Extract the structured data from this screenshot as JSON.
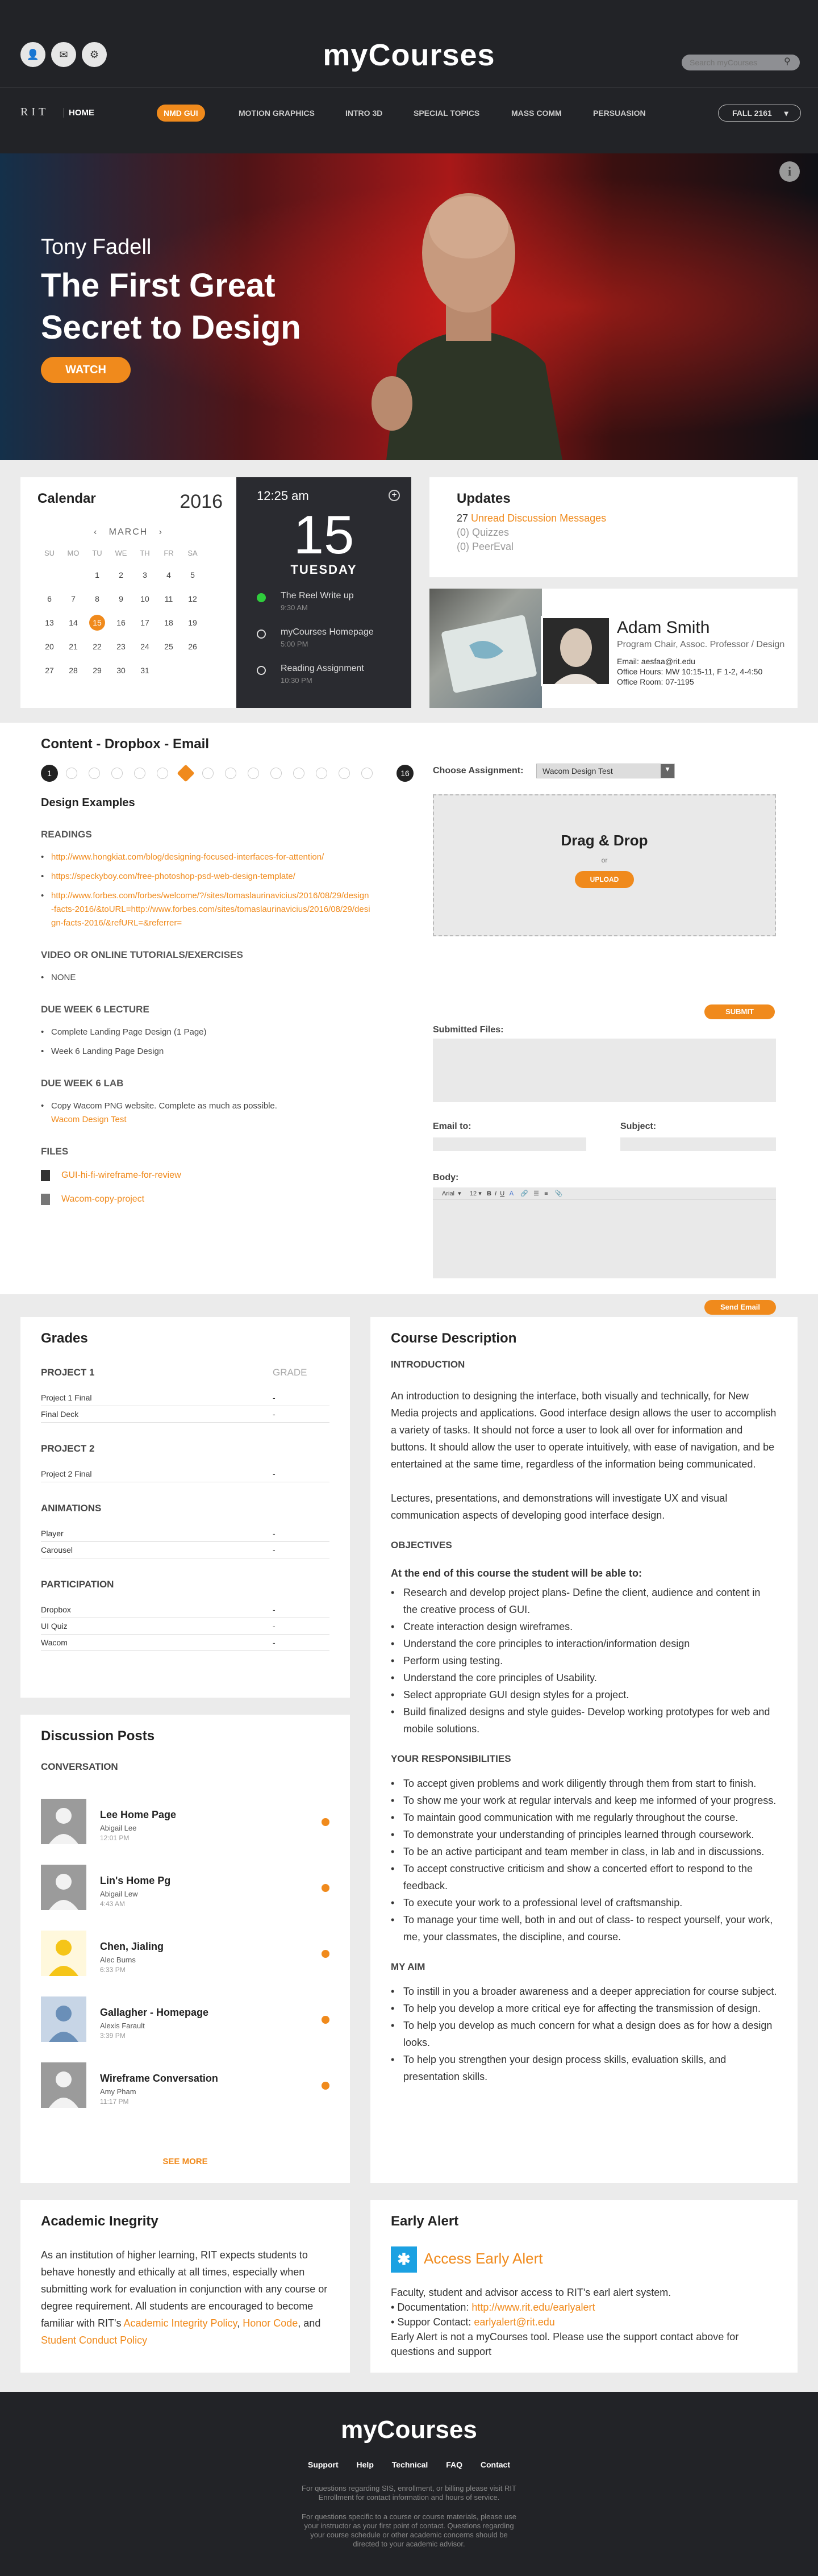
{
  "header": {
    "brand": "myCourses",
    "search_placeholder": "Search myCourses",
    "rit": "RIT",
    "home": "HOME",
    "nav": [
      "NMD GUI",
      "MOTION GRAPHICS",
      "INTRO 3D",
      "SPECIAL TOPICS",
      "MASS COMM",
      "PERSUASION"
    ],
    "term": "FALL 2161"
  },
  "hero": {
    "kicker": "Tony Fadell",
    "title": "The First Great Secret to Design",
    "watch": "WATCH"
  },
  "calendar": {
    "title": "Calendar",
    "year": "2016",
    "month": "MARCH",
    "days_header": [
      "SU",
      "MO",
      "TU",
      "WE",
      "TH",
      "FR",
      "SA"
    ],
    "rows": [
      [
        "",
        "",
        "1",
        "2",
        "3",
        "4",
        "5"
      ],
      [
        "6",
        "7",
        "8",
        "9",
        "10",
        "11",
        "12"
      ],
      [
        "13",
        "14",
        "15",
        "16",
        "17",
        "18",
        "19"
      ],
      [
        "20",
        "21",
        "22",
        "23",
        "24",
        "25",
        "26"
      ],
      [
        "27",
        "28",
        "29",
        "30",
        "31",
        "",
        ""
      ]
    ],
    "selected": "15"
  },
  "day": {
    "time": "12:25 am",
    "num": "15",
    "dow": "TUESDAY",
    "events": [
      {
        "name": "The Reel Write up",
        "time": "9:30 AM"
      },
      {
        "name": "myCourses Homepage",
        "time": "5:00 PM"
      },
      {
        "name": "Reading Assignment",
        "time": "10:30 PM"
      }
    ]
  },
  "updates": {
    "title": "Updates",
    "unread_count": "27",
    "unread": "Unread Discussion Messages",
    "quizzes": "(0) Quizzes",
    "peer": "(0) PeerEval"
  },
  "profile": {
    "name": "Adam Smith",
    "role": "Program Chair, Assoc. Professor / Design",
    "email": "Email: aesfaa@rit.edu",
    "hours": "Office Hours: MW 10:15-11, F 1-2, 4-4:50",
    "room": "Office Room: 07-1195"
  },
  "dropbox": {
    "title": "Content - Dropbox - Email",
    "step_first": "1",
    "step_last": "16",
    "heading": "Design Examples",
    "readings_label": "READINGS",
    "readings": [
      "http://www.hongkiat.com/blog/designing-focused-interfaces-for-attention/",
      "https://speckyboy.com/free-photoshop-psd-web-design-template/",
      "http://www.forbes.com/forbes/welcome/?/sites/tomaslaurinavicius/2016/08/29/design-facts-2016/&toURL=http://www.forbes.com/sites/tomaslaurinavicius/2016/08/29/design-facts-2016/&refURL=&referrer="
    ],
    "video_label": "VIDEO OR ONLINE TUTORIALS/EXERCISES",
    "video_items": [
      "NONE"
    ],
    "lecture_label": "DUE WEEK 6 LECTURE",
    "lecture_items": [
      "Complete Landing Page Design (1 Page)",
      "Week 6 Landing Page Design"
    ],
    "lab_label": "DUE WEEK 6 LAB",
    "lab_item": "Copy Wacom PNG website. Complete as much as possible.",
    "lab_link": "Wacom Design Test",
    "files_label": "FILES",
    "files": [
      "GUI-hi-fi-wireframe-for-review",
      "Wacom-copy-project"
    ],
    "choose_label": "Choose Assignment:",
    "choose_value": "Wacom Design Test",
    "drop_title": "Drag & Drop",
    "drop_or": "or",
    "upload": "UPLOAD",
    "submit": "SUBMIT",
    "submitted_label": "Submitted Files:",
    "email_label": "Email to:",
    "subject_label": "Subject:",
    "body_label": "Body:",
    "font": "Arial",
    "size": "12",
    "send": "Send Email"
  },
  "grades": {
    "title": "Grades",
    "grade_col": "GRADE",
    "sections": [
      {
        "name": "PROJECT 1",
        "rows": [
          [
            "Project 1 Final",
            "-"
          ],
          [
            "Final Deck",
            "-"
          ]
        ]
      },
      {
        "name": "PROJECT 2",
        "rows": [
          [
            "Project 2 Final",
            "-"
          ]
        ]
      },
      {
        "name": "ANIMATIONS",
        "rows": [
          [
            "Player",
            "-"
          ],
          [
            "Carousel",
            "-"
          ]
        ]
      },
      {
        "name": "PARTICIPATION",
        "rows": [
          [
            "Dropbox",
            "-"
          ],
          [
            "UI Quiz",
            "-"
          ],
          [
            "Wacom",
            "-"
          ]
        ]
      }
    ]
  },
  "discussion": {
    "title": "Discussion Posts",
    "sub": "CONVERSATION",
    "posts": [
      {
        "name": "Lee Home Page",
        "author": "Abigail Lee",
        "time": "12:01 PM"
      },
      {
        "name": "Lin's Home Pg",
        "author": "Abigail Lew",
        "time": "4:43 AM"
      },
      {
        "name": "Chen, Jialing",
        "author": "Alec Burns",
        "time": "6:33 PM"
      },
      {
        "name": "Gallagher - Homepage",
        "author": "Alexis Farault",
        "time": "3:39 PM"
      },
      {
        "name": "Wireframe Conversation",
        "author": "Amy Pham",
        "time": "11:17 PM"
      }
    ],
    "more": "SEE MORE"
  },
  "academic": {
    "title": "Academic Inegrity",
    "text": "As an institution of higher learning, RIT expects students to behave honestly and ethically at all times, especially when submitting work for evaluation in conjunction with any course or degree requirement. All students are encouraged to become familiar with RIT's",
    "link1": "Academic Integrity Policy",
    "link2": "Honor Code",
    "and": ", and",
    "link3": "Student Conduct Policy"
  },
  "course": {
    "title": "Course Description",
    "intro_label": "INTRODUCTION",
    "intro1": "An introduction to designing the interface, both visually and technically, for New Media projects and applications. Good interface design allows the user to accomplish a variety of tasks. It should not force a user to look all over for information and buttons. It should allow the user to operate intuitively, with ease of navigation, and be entertained at the same time, regardless of the information being communicated.",
    "intro2": "Lectures, presentations, and demonstrations will investigate UX and visual communication aspects of developing good interface design.",
    "obj_label": "OBJECTIVES",
    "obj_lead": "At the end of this course the student will be able to:",
    "objectives": [
      "Research and develop project plans- Define the client, audience and content in the creative process of GUI.",
      "Create interaction design wireframes.",
      "Understand the core principles to interaction/information design",
      "Perform using testing.",
      "Understand the core principles of Usability.",
      "Select appropriate GUI design styles for a project.",
      "Build finalized designs and style guides-  Develop working prototypes for web and mobile solutions."
    ],
    "resp_label": "YOUR RESPONSIBILITIES",
    "resp": [
      "To accept given problems and work diligently through them from start to finish.",
      "To show me your work at regular intervals and keep me informed of your progress.",
      "To maintain good communication with me regularly throughout the course.",
      "To demonstrate your understanding of principles learned through coursework.",
      "To be an active participant and team member in class, in lab and in discussions.",
      "To accept constructive criticism and show a concerted effort to respond to the feedback.",
      "To execute your work to a professional level of craftsmanship.",
      "To manage your time well, both in and out of class-  to respect yourself, your work, me, your classmates, the discipline, and course."
    ],
    "aim_label": "MY AIM",
    "aim": [
      "To instill in you a broader awareness and a deeper appreciation for course subject.",
      "To help you develop a more critical eye for affecting the transmission of design.",
      "To help you develop as much concern for what a design does as for how a design looks.",
      "To help you strengthen your design process skills, evaluation skills, and presentation skills."
    ]
  },
  "alert": {
    "title": "Early Alert",
    "link": "Access Early Alert",
    "line1": "Faculty, student and advisor access to RIT's earl alert system.",
    "doc_label": "Documentation: ",
    "doc_link": "http://www.rit.edu/earlyalert",
    "sup_label": "Suppor Contact: ",
    "sup_link": "earlyalert@rit.edu",
    "line4": "Early Alert is not a myCourses tool. Please use the support contact above for questions and support"
  },
  "footer": {
    "brand": "myCourses",
    "links": [
      "Support",
      "Help",
      "Technical",
      "FAQ",
      "Contact"
    ],
    "p1": "For questions regarding SIS, enrollment, or billing please visit RIT Enrollment for contact information and hours of service.",
    "p2": "For questions specific to a course or course materials, please use your instructor as your first point of contact. Questions regarding your course schedule or other academic concerns should be directed to your academic advisor."
  },
  "colors": {
    "accent": "#f08a1c",
    "dark": "#222327",
    "bg": "#ebebeb",
    "event_on": "#2fcd3c"
  }
}
